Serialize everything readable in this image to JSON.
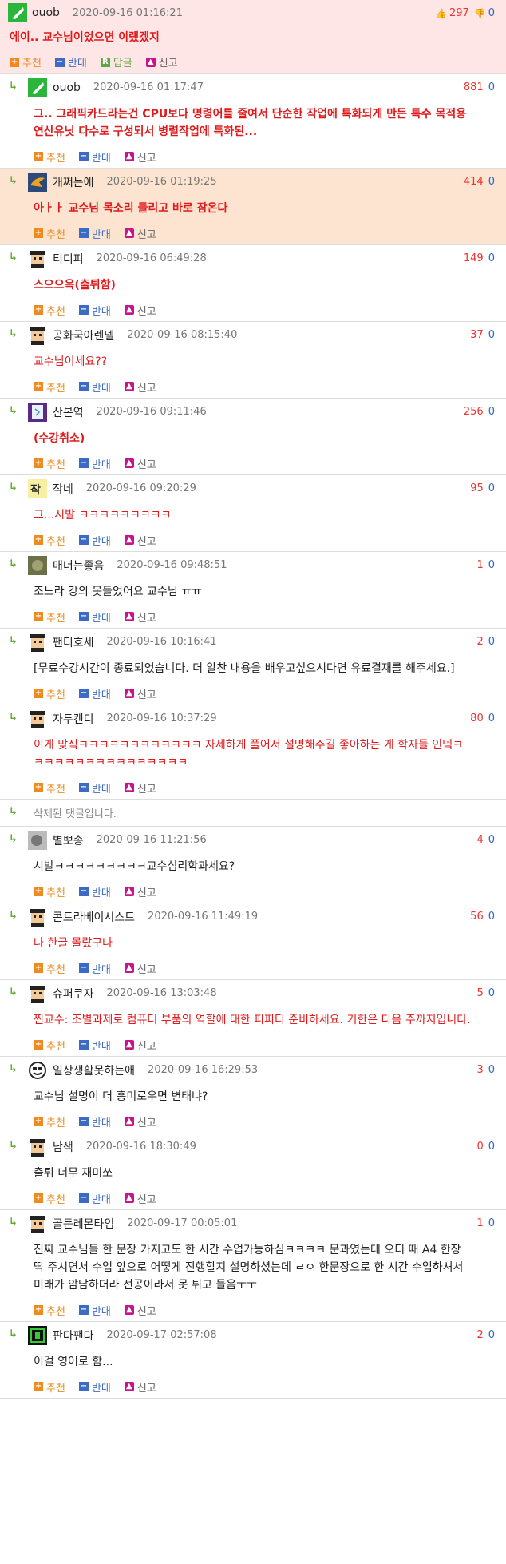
{
  "labels": {
    "recommend": "추천",
    "oppose": "반대",
    "reply": "답글",
    "report": "신고",
    "arrow": "↳"
  },
  "post": {
    "nick": "ouob",
    "date": "2020-09-16 01:16:21",
    "up": "297",
    "down": "0",
    "text": "에이.. 교수님이었으면 이랬겠지"
  },
  "comments": [
    {
      "nick": "ouob",
      "date": "2020-09-16 01:17:47",
      "up": "881",
      "down": "0",
      "text": "그.. 그래픽카드라는건 CPU보다 명령어를 줄여서 단순한 작업에 특화되게 만든 특수 목적용 연산유닛 다수로 구성되서 병렬작업에 특화된...",
      "style": "red bold",
      "avatar": "sword"
    },
    {
      "nick": "개쩌는애",
      "date": "2020-09-16 01:19:25",
      "up": "414",
      "down": "0",
      "text": "아ㅏㅏ 교수님 목소리 들리고 바로 잠온다",
      "style": "red bold",
      "avatar": "bird",
      "hl": true
    },
    {
      "nick": "티디피",
      "date": "2020-09-16 06:49:28",
      "up": "149",
      "down": "0",
      "text": "스으으윽(출튀함)",
      "style": "red bold",
      "avatar": "pixel"
    },
    {
      "nick": "공화국아렌델",
      "date": "2020-09-16 08:15:40",
      "up": "37",
      "down": "0",
      "text": "교수님이세요??",
      "style": "red",
      "avatar": "pixel"
    },
    {
      "nick": "산본역",
      "date": "2020-09-16 09:11:46",
      "up": "256",
      "down": "0",
      "text": "(수강취소)",
      "style": "red bold",
      "avatar": "book"
    },
    {
      "nick": "작네",
      "date": "2020-09-16 09:20:29",
      "up": "95",
      "down": "0",
      "text": "그...시발 ㅋㅋㅋㅋㅋㅋㅋㅋㅋ",
      "style": "red",
      "avatar": "jak"
    },
    {
      "nick": "매너는좋음",
      "date": "2020-09-16 09:48:51",
      "up": "1",
      "down": "0",
      "text": "조느라 강의 못들었어요 교수님 ㅠㅠ",
      "style": "blk",
      "avatar": "photo"
    },
    {
      "nick": "팬티호세",
      "date": "2020-09-16 10:16:41",
      "up": "2",
      "down": "0",
      "text": "[무료수강시간이 종료되었습니다. 더 알찬 내용을 배우고싶으시다면 유료결재를 해주세요.]",
      "style": "blk",
      "avatar": "pixel"
    },
    {
      "nick": "자두캔디",
      "date": "2020-09-16 10:37:29",
      "up": "80",
      "down": "0",
      "text": "이게 맞짘ㅋㅋㅋㅋㅋㅋㅋㅋㅋㅋㅋㅋ 자세하게 풀어서 설명해주길 좋아하는 게 학자들 인뎈ㅋㅋㅋㅋㅋㅋㅋㅋㅋㅋㅋㅋㅋㅋㅋㅋ",
      "style": "red",
      "avatar": "pixel"
    },
    {
      "deleted": true,
      "text": "삭제된 댓글입니다."
    },
    {
      "nick": "별뽀송",
      "date": "2020-09-16 11:21:56",
      "up": "4",
      "down": "0",
      "text": "시발ㅋㅋㅋㅋㅋㅋㅋㅋㅋ교수심리학과세요?",
      "style": "blk",
      "avatar": "photo2"
    },
    {
      "nick": "콘트라베이시스트",
      "date": "2020-09-16 11:49:19",
      "up": "56",
      "down": "0",
      "text": "나 한글 몰랐구나",
      "style": "red",
      "avatar": "pixel"
    },
    {
      "nick": "슈퍼쿠자",
      "date": "2020-09-16 13:03:48",
      "up": "5",
      "down": "0",
      "text": "찐교수: 조별과제로 컴퓨터 부품의 역할에 대한 피피티 준비하세요. 기한은 다음 주까지입니다.",
      "style": "red",
      "avatar": "pixel"
    },
    {
      "nick": "일상생활못하는애",
      "date": "2020-09-16 16:29:53",
      "up": "3",
      "down": "0",
      "text": "교수님 설명이 더 흥미로우면 변태냐?",
      "style": "blk",
      "avatar": "face"
    },
    {
      "nick": "남색",
      "date": "2020-09-16 18:30:49",
      "up": "0",
      "down": "0",
      "text": "출튀 너무 재미쏘",
      "style": "blk",
      "avatar": "pixel"
    },
    {
      "nick": "골든레몬타임",
      "date": "2020-09-17 00:05:01",
      "up": "1",
      "down": "0",
      "text": "진짜 교수님들 한 문장 가지고도 한 시간 수업가능하심ㅋㅋㅋㅋ 문과였는데 오티 때 A4 한장 띡 주시면서 수업 앞으로 어떻게 진행할지 설명하셨는데 ㄹㅇ 한문장으로 한 시간 수업하셔서 미래가 암담하더라 전공이라서 못 튀고 들음ㅜㅜ",
      "style": "blk",
      "avatar": "pixel"
    },
    {
      "nick": "판다팬다",
      "date": "2020-09-17 02:57:08",
      "up": "2",
      "down": "0",
      "text": "이걸 영어로 함...",
      "style": "blk",
      "avatar": "green"
    }
  ]
}
